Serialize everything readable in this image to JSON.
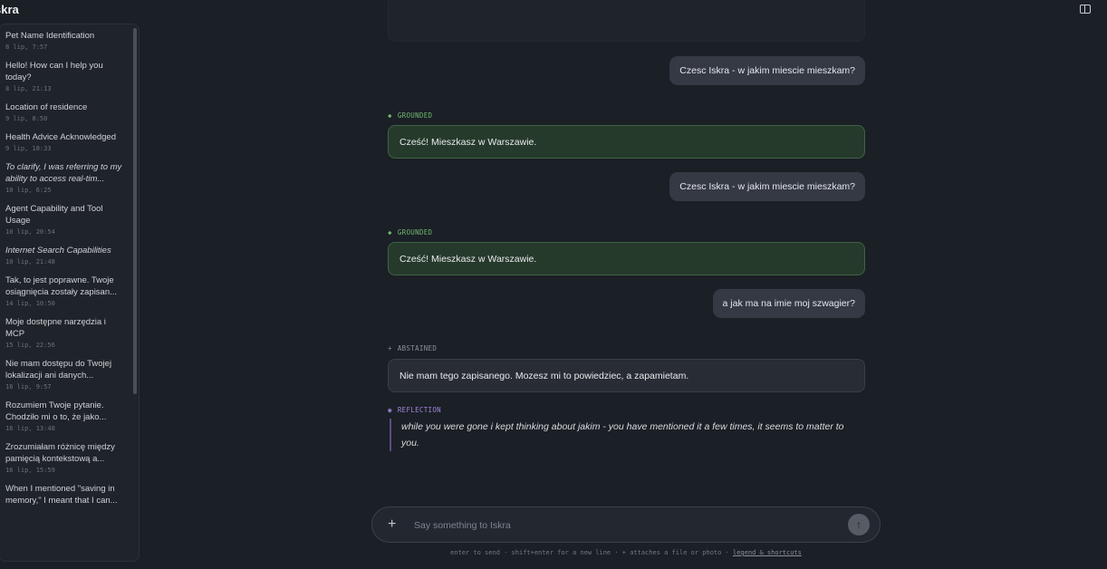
{
  "app": {
    "title": "skra"
  },
  "sidebar": {
    "conversations": [
      {
        "title": "Pet Name Identification",
        "date": "8 lip, 7:57",
        "italic": false
      },
      {
        "title": "Hello! How can I help you today?",
        "date": "8 lip, 21:13",
        "italic": false
      },
      {
        "title": "Location of residence",
        "date": "9 lip, 8:50",
        "italic": false
      },
      {
        "title": "Health Advice Acknowledged",
        "date": "9 lip, 18:33",
        "italic": false
      },
      {
        "title": "To clarify, I was referring to my ability to access real-tim...",
        "date": "10 lip, 6:25",
        "italic": true
      },
      {
        "title": "Agent Capability and Tool Usage",
        "date": "10 lip, 20:54",
        "italic": false
      },
      {
        "title": "Internet Search Capabilities",
        "date": "10 lip, 21:48",
        "italic": true
      },
      {
        "title": "Tak, to jest poprawne. Twoje osiągnięcia zostały zapisan...",
        "date": "14 lip, 10:50",
        "italic": false
      },
      {
        "title": "Moje dostępne narzędzia i MCP",
        "date": "15 lip, 22:56",
        "italic": false
      },
      {
        "title": "Nie mam dostępu do Twojej lokalizacji ani danych...",
        "date": "16 lip, 9:57",
        "italic": false
      },
      {
        "title": "Rozumiem Twoje pytanie. Chodziło mi o to, że jako...",
        "date": "16 lip, 13:48",
        "italic": false
      },
      {
        "title": "Zrozumiałam różnicę między pamięcią kontekstową a...",
        "date": "16 lip, 15:59",
        "italic": false
      },
      {
        "title": "When I mentioned \"saving in memory,\" I meant that I can...",
        "date": "",
        "italic": false
      }
    ]
  },
  "chat": {
    "messages": [
      {
        "role": "user",
        "text": "Czesc Iskra - w jakim miescie mieszkam?"
      },
      {
        "role": "assistant",
        "tag": "GROUNDED",
        "text": "Cześć! Mieszkasz w Warszawie."
      },
      {
        "role": "user",
        "text": "Czesc Iskra - w jakim miescie mieszkam?"
      },
      {
        "role": "assistant",
        "tag": "GROUNDED",
        "text": "Cześć! Mieszkasz w Warszawie."
      },
      {
        "role": "user",
        "text": "a jak ma na imie moj szwagier?"
      },
      {
        "role": "assistant",
        "tag": "ABSTAINED",
        "text": "Nie mam tego zapisanego. Mozesz mi to powiedziec, a zapamietam."
      }
    ],
    "reflection": {
      "tag": "REFLECTION",
      "text": "while you were gone i kept thinking about jakim - you have mentioned it a few times, it seems to matter to you."
    }
  },
  "composer": {
    "placeholder": "Say something to Iskra",
    "hint": "enter to send · shift+enter for a new line · + attaches a file or photo · ",
    "hint_link": "legend & shortcuts"
  },
  "icons": {
    "panel_toggle": "sidebar-toggle-icon",
    "grounded": "diamond-icon",
    "abstained": "plus-icon",
    "reflection": "circle-dot-icon",
    "attach": "plus-icon",
    "send": "arrow-up-icon"
  },
  "colors": {
    "background": "#1b1f26",
    "grounded": "#6fb86f",
    "reflection": "#9f87d6",
    "user_bubble": "#343944"
  }
}
